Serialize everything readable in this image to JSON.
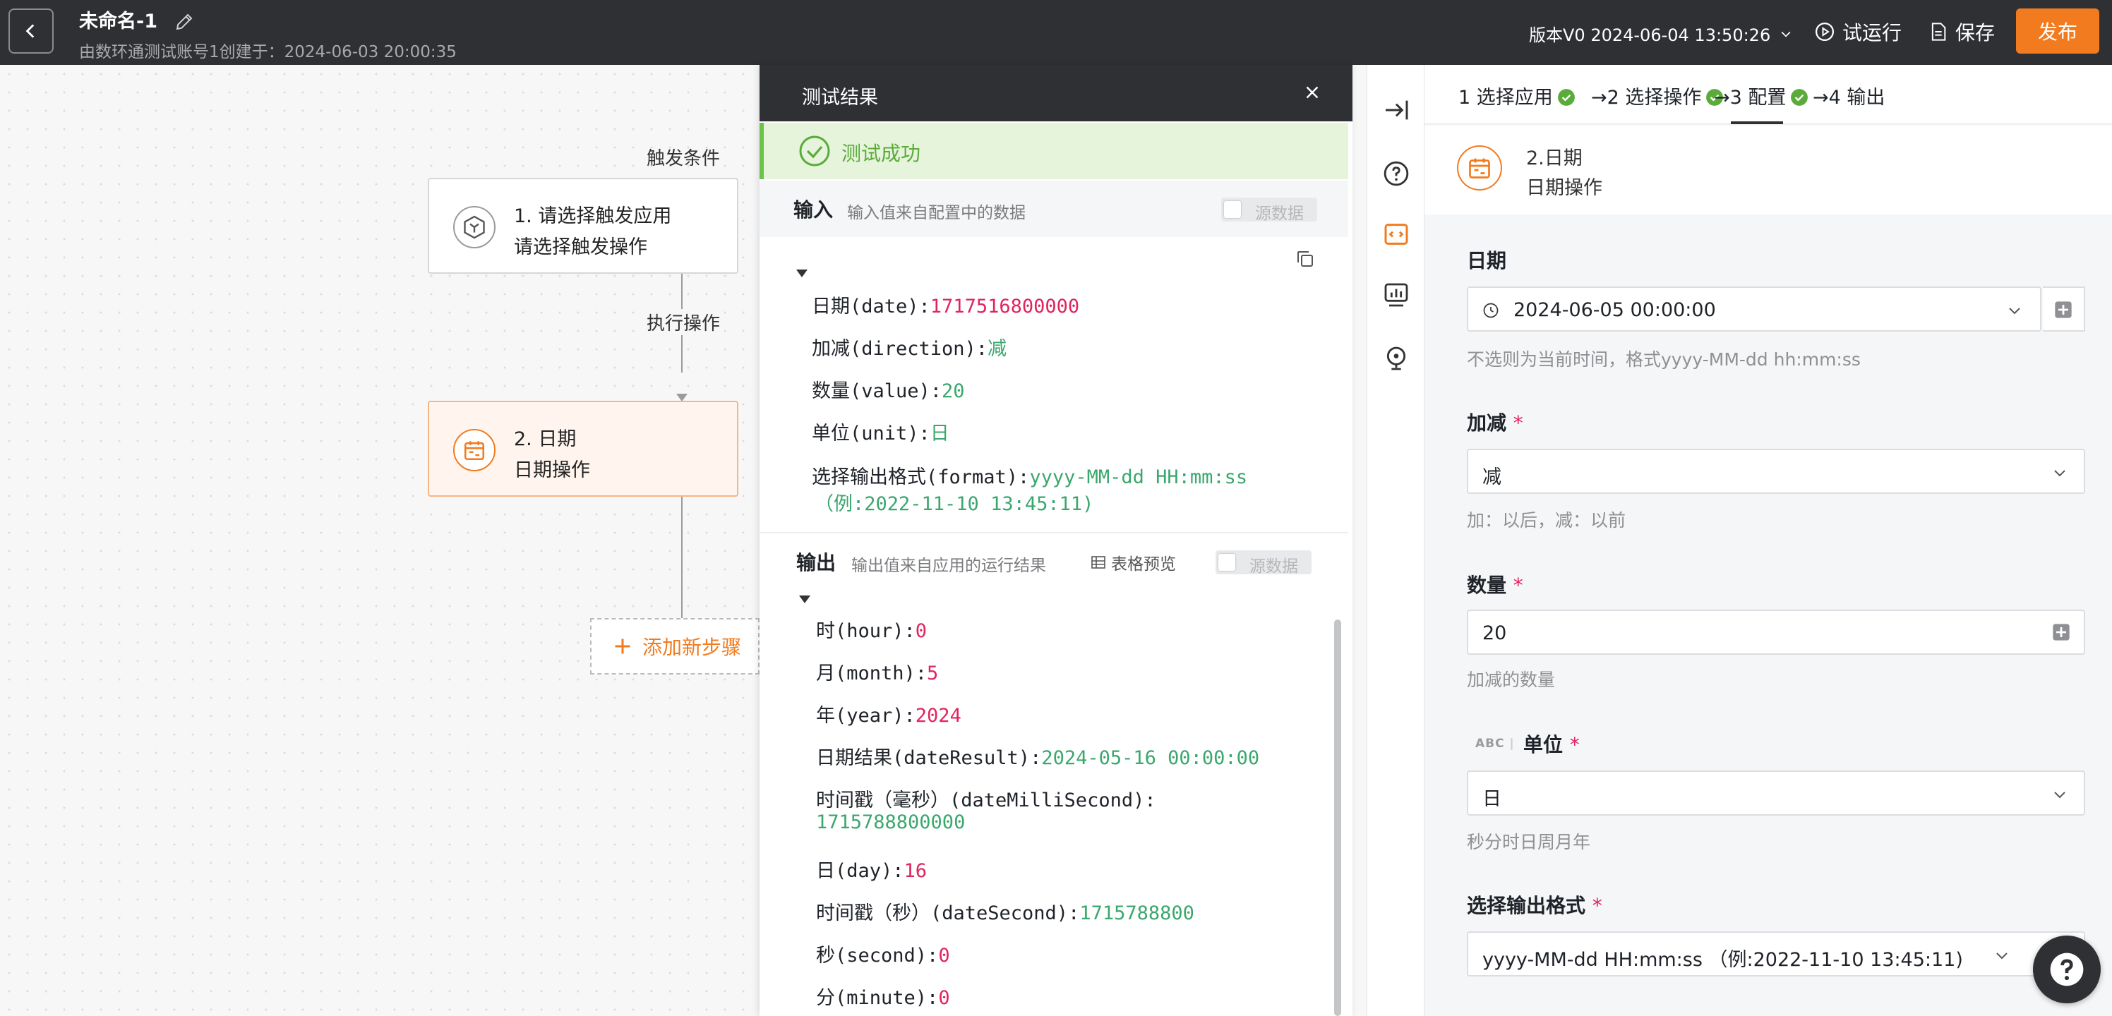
{
  "header": {
    "title": "未命名-1",
    "subtitle": "由数环通测试账号1创建于：2024-06-03 20:00:35",
    "version": "版本V0 2024-06-04 13:50:26",
    "run_label": "试运行",
    "save_label": "保存",
    "publish_label": "发布",
    "accent_color": "#f27b1f"
  },
  "canvas": {
    "trigger_label": "触发条件",
    "action_label": "执行操作",
    "trigger_node": {
      "line1": "1. 请选择触发应用",
      "line2": "请选择触发操作"
    },
    "date_node": {
      "line1": "2. 日期",
      "line2": "日期操作"
    },
    "add_step_label": "添加新步骤"
  },
  "result": {
    "title": "测试结果",
    "success_text": "测试成功",
    "input_title": "输入",
    "input_desc": "输入值来自配置中的数据",
    "output_title": "输出",
    "output_desc": "输出值来自应用的运行结果",
    "table_preview_label": "表格预览",
    "raw_toggle_label": "源数据",
    "input_items": [
      {
        "key": "日期(date):",
        "value": "1717516800000",
        "color": "red"
      },
      {
        "key": "加减(direction):",
        "value": "减",
        "color": "green"
      },
      {
        "key": "数量(value):",
        "value": "20",
        "color": "green"
      },
      {
        "key": "单位(unit):",
        "value": "日",
        "color": "green"
      },
      {
        "key": "选择输出格式(format):",
        "value": "yyyy-MM-dd HH:mm:ss",
        "value2": "（例:2022-11-10 13:45:11)",
        "color": "green"
      }
    ],
    "output_items": [
      {
        "key": "时(hour):",
        "value": "0",
        "color": "red"
      },
      {
        "key": "月(month):",
        "value": "5",
        "color": "red"
      },
      {
        "key": "年(year):",
        "value": "2024",
        "color": "red"
      },
      {
        "key": "日期结果(dateResult):",
        "value": "2024-05-16 00:00:00",
        "color": "green"
      },
      {
        "key": "时间戳（毫秒）(dateMilliSecond):",
        "value": "1715788800000",
        "color": "green"
      },
      {
        "key": "日(day):",
        "value": "16",
        "color": "red"
      },
      {
        "key": "时间戳（秒）(dateSecond):",
        "value": "1715788800",
        "color": "green"
      },
      {
        "key": "秒(second):",
        "value": "0",
        "color": "red"
      },
      {
        "key": "分(minute):",
        "value": "0",
        "color": "red"
      }
    ]
  },
  "config": {
    "steps": [
      {
        "label": "1 选择应用",
        "done": true
      },
      {
        "label": "→2 选择操作",
        "done": true
      },
      {
        "label": "→3 配置",
        "done": true
      },
      {
        "label": "→4 输出",
        "done": false
      }
    ],
    "app_name": "2.日期",
    "app_action": "日期操作",
    "fields": {
      "date": {
        "label": "日期",
        "value": "2024-06-05 00:00:00",
        "hint": "不选则为当前时间，格式yyyy-MM-dd hh:mm:ss"
      },
      "direction": {
        "label": "加减",
        "required_mark": "*",
        "value": "减",
        "hint": "加：以后，减：以前"
      },
      "amount": {
        "label": "数量",
        "required_mark": "*",
        "value": "20",
        "hint": "加减的数量"
      },
      "unit": {
        "label": "单位",
        "required_mark": "*",
        "type_badge": "ABC",
        "value": "日",
        "hint": "秒分时日周月年"
      },
      "format": {
        "label": "选择输出格式",
        "required_mark": "*",
        "value": "yyyy-MM-dd HH:mm:ss （例:2022-11-10 13:45:11)"
      }
    }
  }
}
